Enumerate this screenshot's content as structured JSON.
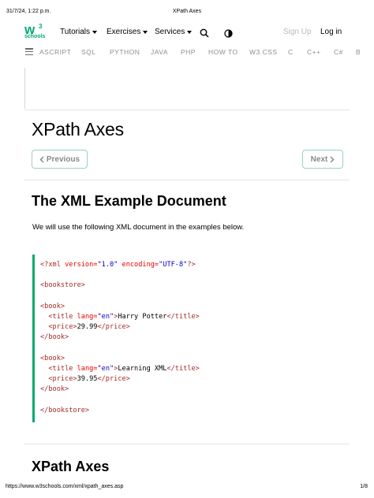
{
  "print": {
    "date": "31/7/24, 1:22 p.m.",
    "title": "XPath Axes",
    "url": "https://www.w3schools.com/xml/xpath_axes.asp",
    "page": "1/8"
  },
  "logo": {
    "mark": "w",
    "superscript": "3",
    "text": "schools",
    "color": "#04aa6d"
  },
  "nav": {
    "tutorials": "Tutorials",
    "exercises": "Exercises",
    "services": "Services",
    "signup": "Sign Up",
    "login": "Log in"
  },
  "subjects": [
    "ASCRIPT",
    "SQL",
    "PYTHON",
    "JAVA",
    "PHP",
    "HOW TO",
    "W3.CSS",
    "C",
    "C++",
    "C#",
    "B"
  ],
  "page": {
    "title": "XPath Axes",
    "prev": "Previous",
    "next": "Next",
    "section1": "The XML Example Document",
    "intro": "We will use the following XML document in the examples below.",
    "section2": "XPath Axes"
  },
  "code": {
    "decl": "<?xml",
    "decl_attr1": "version=",
    "decl_val1": "\"1.0\"",
    "decl_attr2": "encoding=",
    "decl_val2": "\"UTF-8\"",
    "decl_end": "?>",
    "bookstore_open": "<bookstore>",
    "book_open": "<book>",
    "title_open": "<title",
    "lang_attr": "lang=",
    "lang_val": "\"en\"",
    "gt": ">",
    "title1_text": "Harry Potter",
    "title_close": "</title>",
    "price_open": "<price>",
    "price1": "29.99",
    "price_close": "</price>",
    "book_close": "</book>",
    "title2_text": "Learning XML",
    "price2": "39.95",
    "bookstore_close": "</bookstore>"
  },
  "colors": {
    "accent": "#04aa6d",
    "tag": "#a52a2a",
    "attr": "#e80000",
    "value": "#0000cd"
  }
}
